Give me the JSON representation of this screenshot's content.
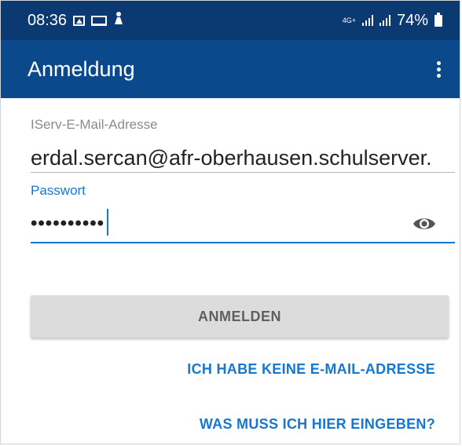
{
  "status_bar": {
    "time": "08:36",
    "network": "4G+",
    "battery": "74%",
    "icons": [
      "image-icon",
      "laptop-icon",
      "app-notification-icon",
      "signal-icon",
      "battery-icon"
    ]
  },
  "app_bar": {
    "title": "Anmeldung",
    "menu_icon": "more-vert-icon"
  },
  "form": {
    "email": {
      "label": "IServ-E-Mail-Adresse",
      "value": "erdal.sercan@afr-oberhausen.schulserver."
    },
    "password": {
      "label": "Passwort",
      "masked_value": "••••••••••",
      "toggle_icon": "eye-icon"
    }
  },
  "actions": {
    "login_label": "ANMELDEN",
    "no_email_label": "ICH HABE KEINE E-MAIL-ADRESSE",
    "help_label": "WAS MUSS ICH HIER EINGEBEN?"
  },
  "colors": {
    "status_bar": "#0b3a72",
    "app_bar": "#0a4a8c",
    "accent": "#1677d2",
    "button_bg": "#dcdcdc"
  }
}
